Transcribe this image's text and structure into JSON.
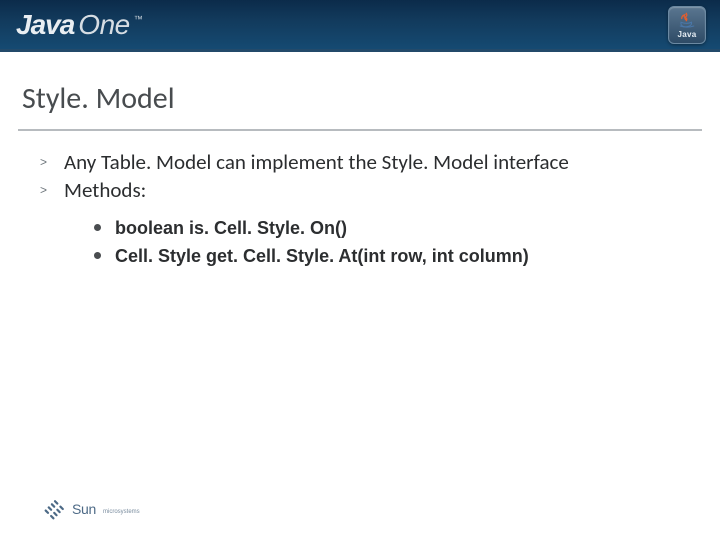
{
  "header": {
    "logo_part1": "Java",
    "logo_part2": "One",
    "logo_tm": "™",
    "badge_text": "Java"
  },
  "title": "Style. Model",
  "bullets_lvl1": [
    "Any Table. Model can implement the Style. Model interface",
    "Methods:"
  ],
  "bullets_lvl2": [
    "boolean is. Cell. Style. On()",
    "Cell. Style get. Cell. Style. At(int row, int column)"
  ],
  "footer": {
    "sun": "Sun",
    "ms": "microsystems"
  }
}
